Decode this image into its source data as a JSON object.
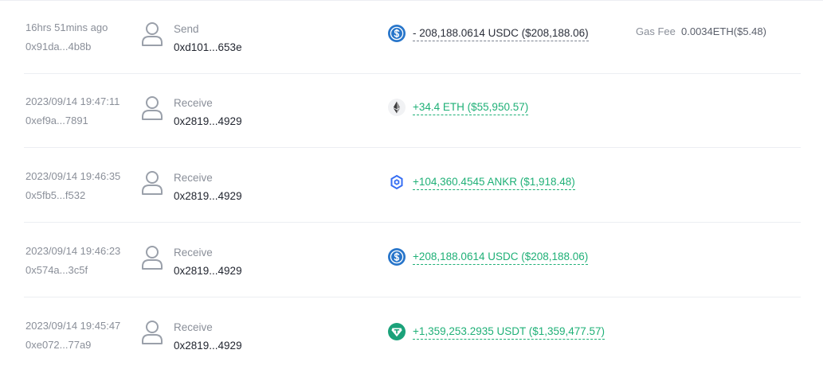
{
  "transactions": [
    {
      "time": "16hrs 51mins ago",
      "hash": "0x91da...4b8b",
      "direction": "Send",
      "counterparty": "0xd101...653e",
      "token_icon": "usdc-icon",
      "amount": "- 208,188.0614 USDC ($208,188.06)",
      "flow": "out",
      "gas_fee_label": "Gas Fee",
      "gas_fee_value": "0.0034ETH($5.48)"
    },
    {
      "time": "2023/09/14 19:47:11",
      "hash": "0xef9a...7891",
      "direction": "Receive",
      "counterparty": "0x2819...4929",
      "token_icon": "eth-icon",
      "amount": "+34.4 ETH ($55,950.57)",
      "flow": "in"
    },
    {
      "time": "2023/09/14 19:46:35",
      "hash": "0x5fb5...f532",
      "direction": "Receive",
      "counterparty": "0x2819...4929",
      "token_icon": "ankr-icon",
      "amount": "+104,360.4545 ANKR ($1,918.48)",
      "flow": "in"
    },
    {
      "time": "2023/09/14 19:46:23",
      "hash": "0x574a...3c5f",
      "direction": "Receive",
      "counterparty": "0x2819...4929",
      "token_icon": "usdc-icon",
      "amount": "+208,188.0614 USDC ($208,188.06)",
      "flow": "in"
    },
    {
      "time": "2023/09/14 19:45:47",
      "hash": "0xe072...77a9",
      "direction": "Receive",
      "counterparty": "0x2819...4929",
      "token_icon": "usdt-icon",
      "amount": "+1,359,253.2935 USDT ($1,359,477.57)",
      "flow": "in"
    }
  ],
  "colors": {
    "usdc": "#2775ca",
    "usdt": "#1ba27a",
    "ankr": "#356df3",
    "incoming": "#1fb077",
    "muted": "#8a8f99"
  }
}
